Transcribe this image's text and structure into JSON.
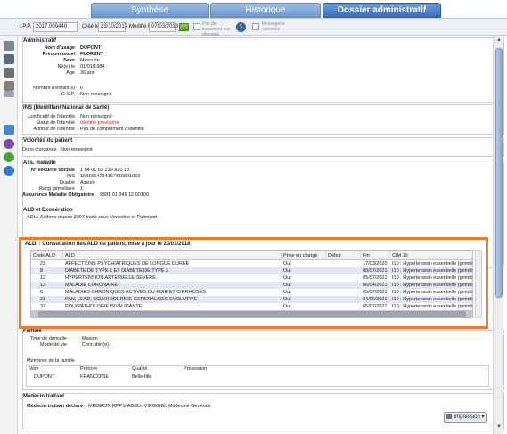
{
  "tabs": [
    {
      "label": "Synthèse"
    },
    {
      "label": "Historique"
    },
    {
      "label": "Dossier administratif"
    }
  ],
  "header": {
    "ipp_label": "I.P.P.",
    "ipp_value": "2017.000440",
    "created_label": "Créé le",
    "created_value": "23/10/2017",
    "modified_label": "Modifié le",
    "modified_value": "07/03/2018",
    "no_treatment_label": "Pas de traitement des données",
    "messaging_label": "Messagerie autorisée"
  },
  "administratif": {
    "title": "Administratif",
    "nom_label": "Nom d'usage",
    "nom_value": "DUPONT",
    "prenom_label": "Prénom usuel",
    "prenom_value": "FLORENT",
    "sexe_label": "Sexe",
    "sexe_value": "Masculin",
    "ne_label": "Né(e) le",
    "ne_value": "01/01/1984",
    "age_label": "Age",
    "age_value": "36 ans",
    "enfants_label": "Nombre d'enfant(s)",
    "enfants_value": "0",
    "csp_label": "C.S.P.",
    "csp_value": "Non renseigné"
  },
  "ins": {
    "title": "INS (Identifiant National de Santé)",
    "justif_label": "Justificatif de l'identité",
    "justif_value": "Non renseigné",
    "statut_label": "Statut de l'identité",
    "statut_value": "Identité provisoire",
    "attribut_label": "Attribut de l'identité",
    "attribut_value": "Pas de complément d'identité"
  },
  "volontes": {
    "title": "Volontés du patient",
    "dons_label": "Dons d'organes",
    "dons_value": "Non renseigné"
  },
  "assmaladie": {
    "title": "Ass. maladie",
    "nss_label": "N° sécurité sociale",
    "nss_value": "1 84 01 63 220 820 18",
    "ins_label": "INS",
    "ins_value": "1581554734167410801053",
    "qualite_label": "Qualité",
    "qualite_value": "Assuré",
    "rang_label": "Rang gémellaire",
    "rang_value": "1",
    "assurance_label": "Assurance Maladie Obligatoire",
    "assurance_value": "9881 01 349 12 00100"
  },
  "ald_exo": {
    "title": "ALD et Exonération",
    "text": "ADL : Asthme depuis 2007 traité sous Ventoline et Pulmicort"
  },
  "ald_table": {
    "title": "ALDi : Consultation des ALD du patient, mise à jour le 23/01/2018",
    "columns": [
      "Code ALD",
      "ALD",
      "Prise en charge",
      "Début",
      "Fin",
      "CIM 10"
    ],
    "rows": [
      [
        "23",
        "AFFECTIONS PSYCHIATRIQUES DE LONGUE DUREE",
        "Oui",
        "",
        "17/03/2020",
        "I10 : Hypertension essentielle (primitive)"
      ],
      [
        "8",
        "DIABETE DE TYPE 1 ET DIABETE DE TYPE 2",
        "Oui",
        "",
        "08/07/2021",
        "I10 : Hypertension essentielle (primitive)"
      ],
      [
        "12",
        "HYPERTENSION ARTERIELLE SEVERE",
        "Oui",
        "",
        "05/07/2021",
        "I10 : Hypertension essentielle (primitive)"
      ],
      [
        "13",
        "MALADIE CORONAIRE",
        "Oui",
        "",
        "06/04/2021",
        "I10 : Hypertension essentielle (primitive)"
      ],
      [
        "6",
        "MALADIES CHRONIQUES ACTIVES DU FOIE ET CIRRHOSES",
        "Oui",
        "",
        "05/07/2021",
        "I10 : Hypertension essentielle (primitive)"
      ],
      [
        "21",
        "PAN, LEAD, SCLERODERMIE GENERALISEE EVOLUTIVE",
        "Oui",
        "",
        "04/06/2021",
        "I10 : Hypertension essentielle (primitive)"
      ],
      [
        "32",
        "POLYPATHOLOGIE INVALIDANTE",
        "Oui",
        "",
        "05/07/2021",
        "I10 : Hypertension essentielle (primitive)"
      ]
    ]
  },
  "famille": {
    "title": "Famille",
    "domicile_label": "Type de domicile",
    "domicile_value": "Maison",
    "vie_label": "Mode de vie",
    "vie_value": "Concubin(e)",
    "membres_label": "Membres de la famille",
    "columns": [
      "Nom",
      "Prénom",
      "Qualité",
      "Profession"
    ],
    "rows": [
      [
        "DUPONT",
        "FRANCOISE",
        "Belle-fille",
        ""
      ]
    ]
  },
  "medecin": {
    "title": "Médecin traitant",
    "declare_label": "Médecin traitant déclaré",
    "declare_value": "MEDECIN RPPS-ADELI, VIRGINIE, Médecine Générale"
  },
  "impression_label": "Impression",
  "colors": {
    "tab_active": "#3d6fb8",
    "highlight_border": "#ec7a2c",
    "row_alt": "#e4e8f5",
    "provisional": "#cc2222"
  }
}
